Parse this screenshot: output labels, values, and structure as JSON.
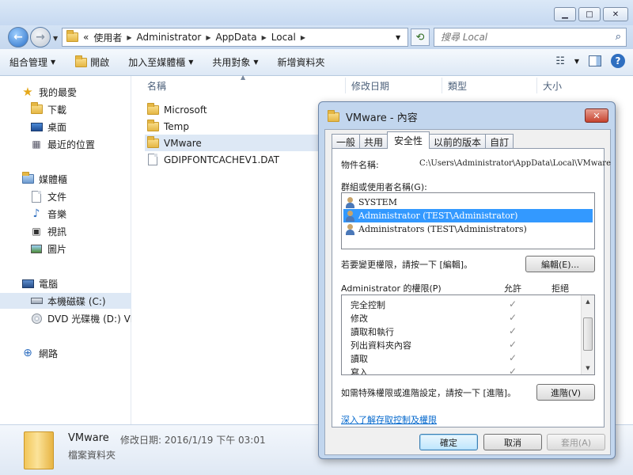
{
  "window": {
    "minimize_glyph": "▁",
    "maximize_glyph": "□",
    "close_glyph": "✕"
  },
  "address": {
    "overflow": "«",
    "path": [
      "使用者",
      "Administrator",
      "AppData",
      "Local"
    ],
    "search_placeholder": "搜尋 Local"
  },
  "toolbar": {
    "organize": "組合管理",
    "open": "開啟",
    "include_library": "加入至媒體櫃",
    "share_with": "共用對象",
    "new_folder": "新增資料夾"
  },
  "nav": {
    "favorites": "我的最愛",
    "downloads": "下載",
    "desktop": "桌面",
    "recent": "最近的位置",
    "libraries": "媒體櫃",
    "documents": "文件",
    "music": "音樂",
    "videos": "視訊",
    "pictures": "圖片",
    "computer": "電腦",
    "local_disk": "本機磁碟 (C:)",
    "dvd": "DVD 光碟機 (D:) VM",
    "network": "網路"
  },
  "columns": {
    "name": "名稱",
    "modified": "修改日期",
    "type": "類型",
    "size": "大小"
  },
  "files": [
    {
      "name": "Microsoft",
      "kind": "folder"
    },
    {
      "name": "Temp",
      "kind": "folder"
    },
    {
      "name": "VMware",
      "kind": "folder"
    },
    {
      "name": "GDIPFONTCACHEV1.DAT",
      "kind": "file"
    }
  ],
  "details": {
    "name": "VMware",
    "modified_label": "修改日期:",
    "modified_value": "2016/1/19 下午 03:01",
    "type": "檔案資料夾"
  },
  "dialog": {
    "title": "VMware - 內容",
    "tabs": [
      "一般",
      "共用",
      "安全性",
      "以前的版本",
      "自訂"
    ],
    "active_tab": 2,
    "object_label": "物件名稱:",
    "object_value": "C:\\Users\\Administrator\\AppData\\Local\\VMware",
    "groups_label": "群組或使用者名稱(G):",
    "principals": [
      "SYSTEM",
      "Administrator (TEST\\Administrator)",
      "Administrators (TEST\\Administrators)"
    ],
    "selected_principal": 1,
    "change_hint": "若要變更權限，請按一下 [編輯]。",
    "edit_button": "編輯(E)...",
    "perm_label": "Administrator 的權限(P)",
    "allow_header": "允許",
    "deny_header": "拒絕",
    "permissions": [
      "完全控制",
      "修改",
      "讀取和執行",
      "列出資料夾內容",
      "讀取",
      "寫入"
    ],
    "check_glyph": "✓",
    "special_hint": "如需特殊權限或進階設定，請按一下 [進階]。",
    "advanced_button": "進階(V)",
    "learn_link": "深入了解存取控制及權限",
    "ok": "確定",
    "cancel": "取消",
    "apply": "套用(A)"
  },
  "colors": {
    "selection": "#3399ff",
    "link": "#0066cc",
    "aero_frame": "#c2d6ee"
  }
}
